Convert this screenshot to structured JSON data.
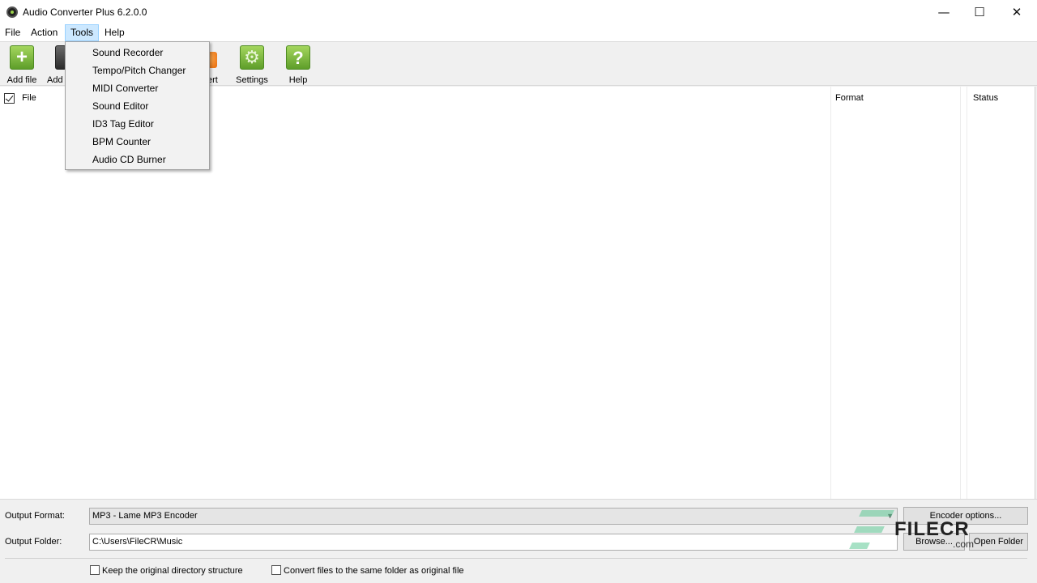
{
  "window": {
    "title": "Audio Converter Plus 6.2.0.0",
    "minimize": "—",
    "maximize": "☐",
    "close": "✕"
  },
  "menu": {
    "file": "File",
    "action": "Action",
    "tools": "Tools",
    "help": "Help"
  },
  "toolbar": {
    "add_file": "Add file",
    "add_folder": "Add",
    "convert": "ert",
    "settings": "Settings",
    "help": "Help"
  },
  "tools_menu": {
    "items": [
      "Sound Recorder",
      "Tempo/Pitch Changer",
      "MIDI Converter",
      "Sound Editor",
      "ID3 Tag Editor",
      "BPM Counter",
      "Audio CD Burner"
    ]
  },
  "file_list": {
    "columns": {
      "file": "File",
      "format": "Format",
      "status": "Status"
    },
    "select_all_checked": true
  },
  "output": {
    "format_label": "Output Format:",
    "format_value": "MP3  - Lame MP3 Encoder",
    "folder_label": "Output Folder:",
    "folder_value": "C:\\Users\\FileCR\\Music",
    "encoder_options": "Encoder options...",
    "browse": "Browse...",
    "open_folder": "Open Folder"
  },
  "options": {
    "keep_structure": "Keep the original directory structure",
    "same_folder": "Convert files to the same folder as original file"
  },
  "watermark": {
    "text": "FILECR",
    "sub": ".com"
  },
  "colors": {
    "menu_highlight": "#cce8ff",
    "icon_green": "#6fae35",
    "icon_orange": "#e86b0a",
    "watermark": "#5fc896"
  }
}
